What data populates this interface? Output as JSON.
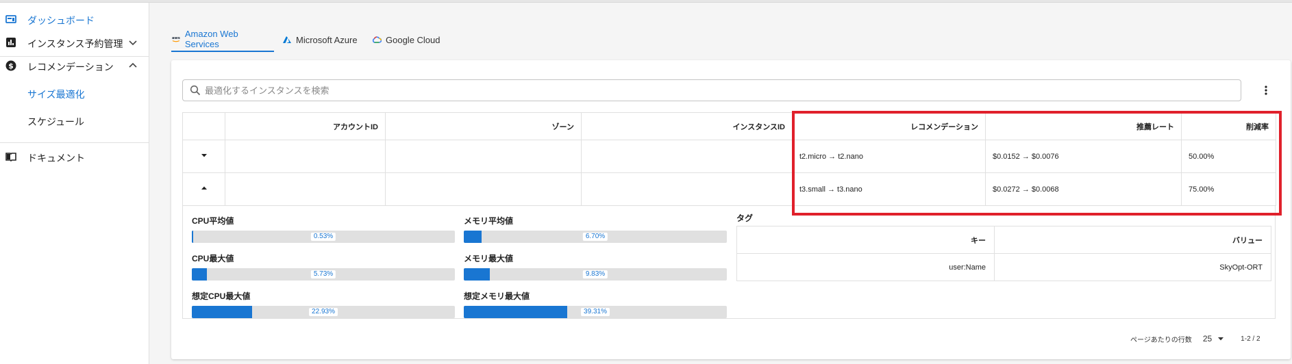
{
  "sidebar": {
    "items": [
      {
        "label": "ダッシュボード"
      },
      {
        "label": "インスタンス予約管理"
      },
      {
        "label": "レコメンデーション"
      },
      {
        "label": "サイズ最適化"
      },
      {
        "label": "スケジュール"
      },
      {
        "label": "ドキュメント"
      }
    ]
  },
  "tabs": [
    {
      "label": "Amazon Web Services"
    },
    {
      "label": "Microsoft Azure"
    },
    {
      "label": "Google Cloud"
    }
  ],
  "search": {
    "placeholder": "最適化するインスタンスを検索"
  },
  "table": {
    "headers": [
      "",
      "アカウントID",
      "ゾーン",
      "インスタンスID",
      "レコメンデーション",
      "推薦レート",
      "削減率"
    ],
    "rows": [
      {
        "account": "",
        "zone": "",
        "instance": "",
        "recommendation": "t2.micro → t2.nano",
        "rate": "$0.0152 → $0.0076",
        "reduction": "50.00%",
        "expanded": false
      },
      {
        "account": "",
        "zone": "",
        "instance": "",
        "recommendation": "t3.small → t3.nano",
        "rate": "$0.0272 → $0.0068",
        "reduction": "75.00%",
        "expanded": true
      }
    ]
  },
  "detail": {
    "metrics": [
      {
        "label": "CPU平均値",
        "value": "0.53%",
        "fraction": 0.0053
      },
      {
        "label": "メモリ平均値",
        "value": "6.70%",
        "fraction": 0.067
      },
      {
        "label": "CPU最大値",
        "value": "5.73%",
        "fraction": 0.0573
      },
      {
        "label": "メモリ最大値",
        "value": "9.83%",
        "fraction": 0.0983
      },
      {
        "label": "想定CPU最大値",
        "value": "22.93%",
        "fraction": 0.2293
      },
      {
        "label": "想定メモリ最大値",
        "value": "39.31%",
        "fraction": 0.3931
      }
    ],
    "tags_title": "タグ",
    "tags_headers": [
      "キー",
      "バリュー"
    ],
    "tags": [
      {
        "key": "user:Name",
        "value": "SkyOpt-ORT"
      }
    ]
  },
  "pagination": {
    "rows_per_page_label": "ページあたりの行数",
    "rows_per_page": "25",
    "range": "1-2 / 2"
  },
  "colors": {
    "accent": "#1976d2",
    "highlight": "#e0202b"
  }
}
